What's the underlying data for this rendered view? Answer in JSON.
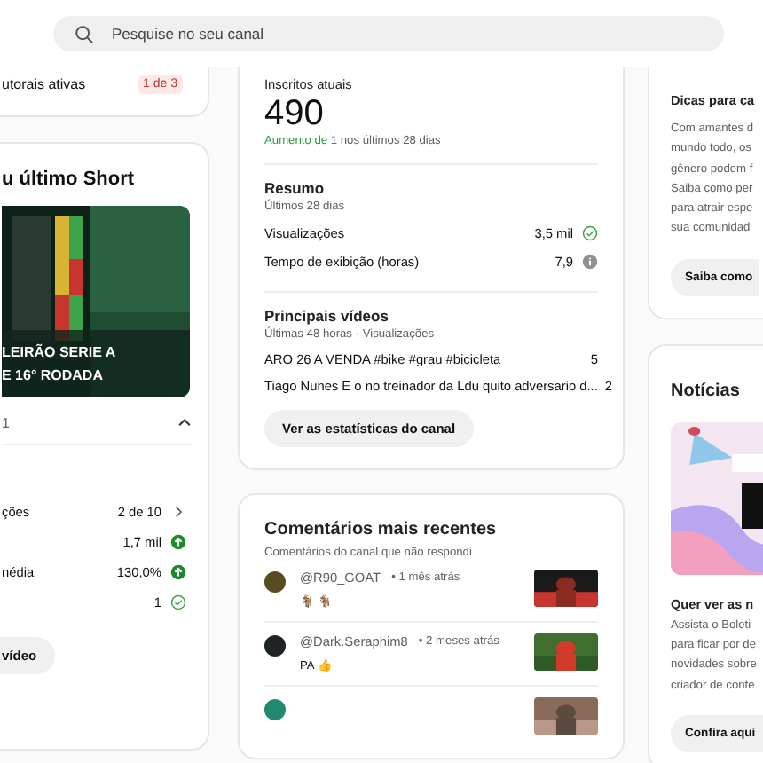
{
  "search": {
    "placeholder": "Pesquise no seu canal"
  },
  "left": {
    "status": {
      "label": "utorais ativas",
      "badge": "1 de 3"
    },
    "short": {
      "title": "u último Short",
      "caption": [
        "LEIRÃO SERIE A",
        "E 16° RODADA"
      ],
      "count": "1",
      "expanded": true,
      "rows": [
        {
          "label": "ções",
          "value": "2 de 10",
          "kind": "link"
        },
        {
          "value": "1,7 mil",
          "kind": "rising"
        },
        {
          "label": "nédia",
          "value": "130,0%",
          "kind": "rising"
        },
        {
          "value": "1",
          "kind": "ok"
        }
      ],
      "button": "vídeo"
    }
  },
  "subscribers": {
    "label": "Inscritos atuais",
    "count": "490",
    "growth": "Aumento de 1",
    "growth_rest": " nos últimos 28 dias",
    "summary": {
      "title": "Resumo",
      "subtitle": "Últimos 28 dias",
      "rows": [
        {
          "label": "Visualizações",
          "value": "3,5 mil",
          "kind": "ok"
        },
        {
          "label": "Tempo de exibição (horas)",
          "value": "7,9",
          "kind": "info"
        }
      ]
    },
    "top_videos": {
      "title": "Principais vídeos",
      "subtitle": "Últimas 48 horas · Visualizações",
      "rows": [
        {
          "title": "ARO 26 A VENDA #bike #grau #bicicleta",
          "views": "5"
        },
        {
          "title": "Tiago Nunes E o no treinador da Ldu quito adversario d...",
          "views": "2"
        }
      ]
    },
    "button": "Ver as estatísticas do canal"
  },
  "comments": {
    "title": "Comentários mais recentes",
    "subtitle": "Comentários do canal que não respondi",
    "items": [
      {
        "author": "@R90_GOAT",
        "time": "• 1 mês atrás",
        "text": "🐐 🐐",
        "color": "#5a4a20"
      },
      {
        "author": "@Dark.Seraphim8",
        "time": "• 2 meses atrás",
        "text": "PA 👍",
        "color": "#1e2426"
      },
      {
        "color": "#1f8a70"
      }
    ]
  },
  "tips": {
    "title": "Dicas para ca",
    "lines": [
      "Com amantes d",
      "mundo todo, os",
      "gênero podem f",
      "Saiba como per",
      "para atrair espe",
      "sua comunidad"
    ],
    "button": "Saiba como"
  },
  "news": {
    "title": "Notícias",
    "headline": "Quer ver as n",
    "lines": [
      "Assista o Boleti",
      "para ficar por de",
      "novidades sobre",
      "criador de conte"
    ],
    "button": "Confira aqui"
  }
}
